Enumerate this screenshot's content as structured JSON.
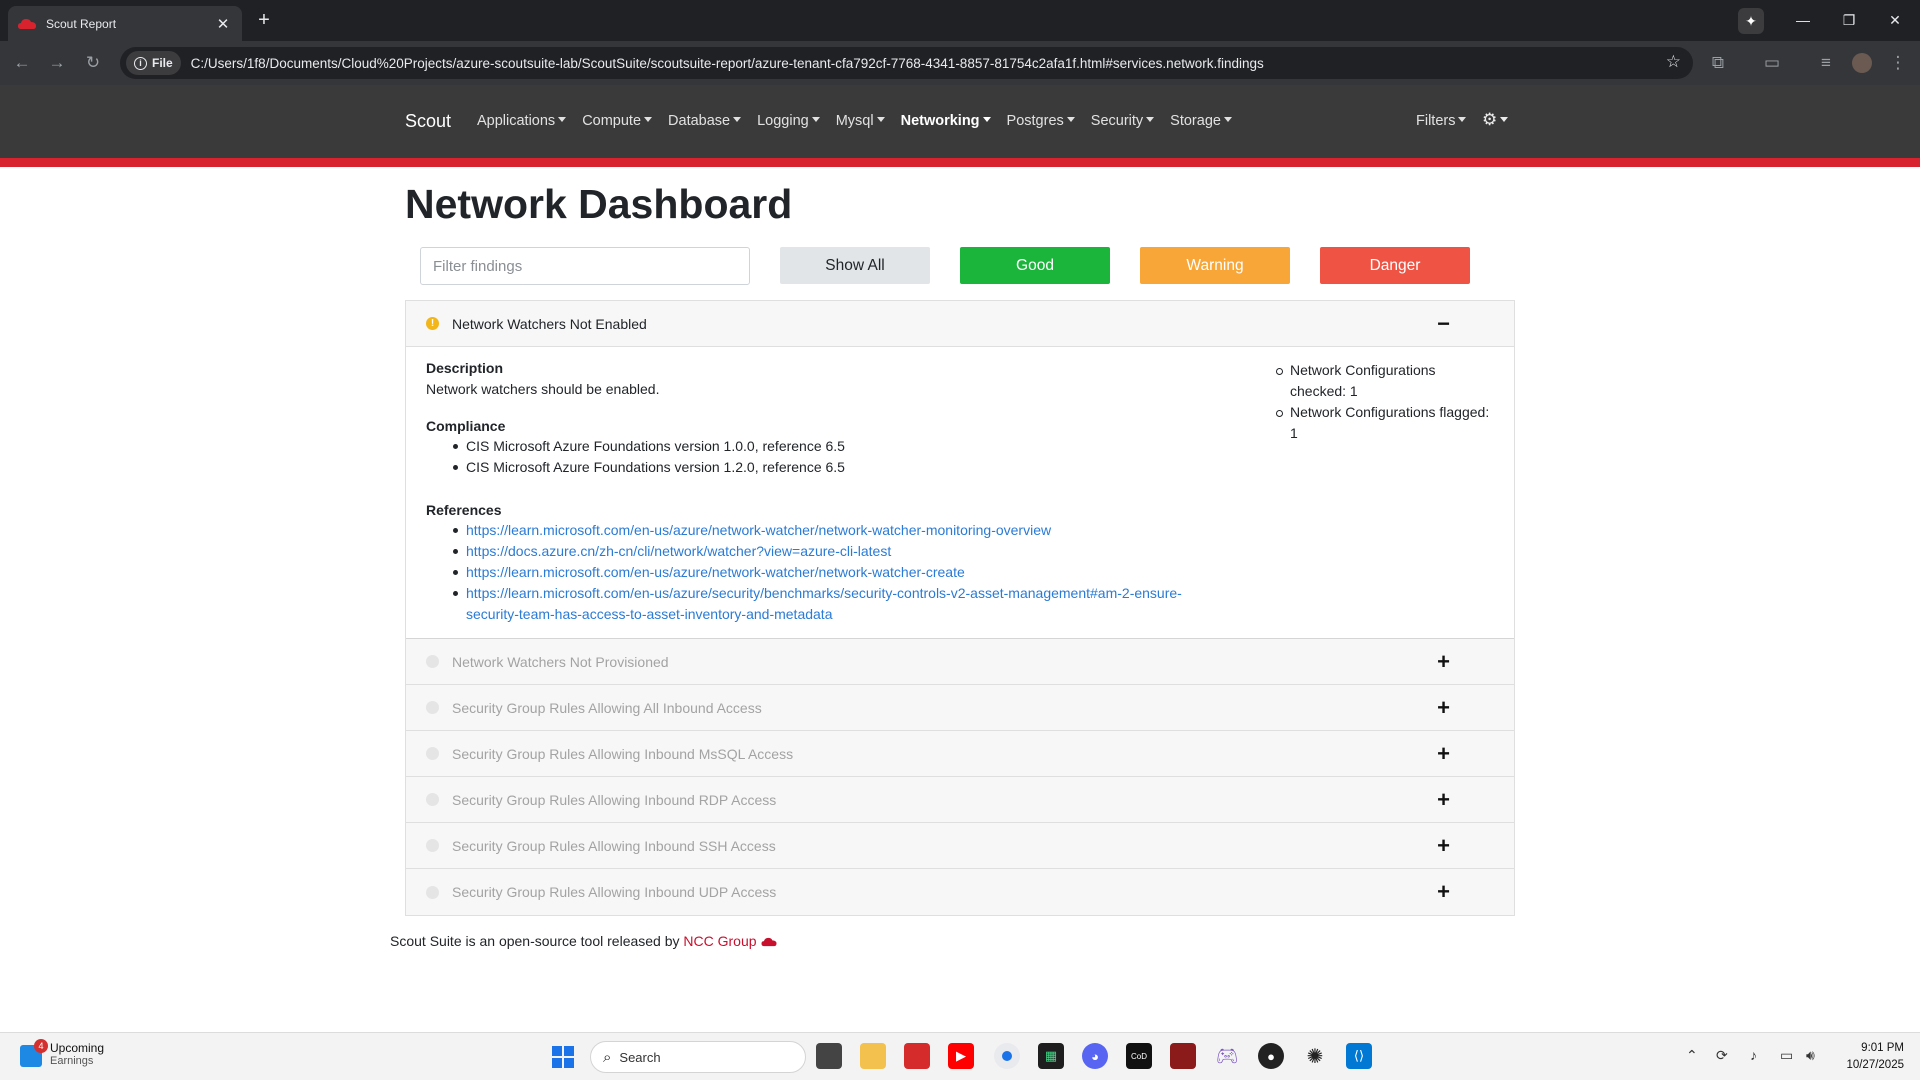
{
  "browser": {
    "tab_title": "Scout Report",
    "tab_close": "✕",
    "new_tab": "+",
    "file_chip": "File",
    "url": "C:/Users/1f8/Documents/Cloud%20Projects/azure-scoutsuite-lab/ScoutSuite/scoutsuite-report/azure-tenant-cfa792cf-7768-4341-8857-81754c2afa1f.html#services.network.findings"
  },
  "nav": {
    "brand": "Scout",
    "menus": [
      "Applications",
      "Compute",
      "Database",
      "Logging",
      "Mysql",
      "Networking",
      "Postgres",
      "Security",
      "Storage"
    ],
    "active": "Networking",
    "filters": "Filters"
  },
  "page": {
    "title": "Network Dashboard",
    "filter_placeholder": "Filter findings",
    "buttons": {
      "show_all": "Show All",
      "good": "Good",
      "warning": "Warning",
      "danger": "Danger"
    }
  },
  "expanded": {
    "title": "Network Watchers Not Enabled",
    "toggle": "−",
    "description_label": "Description",
    "description": "Network watchers should be enabled.",
    "compliance_label": "Compliance",
    "compliance": [
      "CIS Microsoft Azure Foundations version 1.0.0, reference 6.5",
      "CIS Microsoft Azure Foundations version 1.2.0, reference 6.5"
    ],
    "references_label": "References",
    "references": [
      "https://learn.microsoft.com/en-us/azure/network-watcher/network-watcher-monitoring-overview",
      "https://docs.azure.cn/zh-cn/cli/network/watcher?view=azure-cli-latest",
      "https://learn.microsoft.com/en-us/azure/network-watcher/network-watcher-create",
      "https://learn.microsoft.com/en-us/azure/security/benchmarks/security-controls-v2-asset-management#am-2-ensure-",
      "security-team-has-access-to-asset-inventory-and-metadata"
    ],
    "stats": [
      "Network Configurations checked: 1",
      "Network Configurations flagged: 1"
    ]
  },
  "collapsed": [
    "Network Watchers Not Provisioned",
    "Security Group Rules Allowing All Inbound Access",
    "Security Group Rules Allowing Inbound MsSQL Access",
    "Security Group Rules Allowing Inbound RDP Access",
    "Security Group Rules Allowing Inbound SSH Access",
    "Security Group Rules Allowing Inbound UDP Access"
  ],
  "collapsed_toggle": "+",
  "footer": {
    "text": "Scout Suite is an open-source tool released by ",
    "link": "NCC Group"
  },
  "taskbar": {
    "weather_title": "Upcoming",
    "weather_sub": "Earnings",
    "badge": "4",
    "search": "Search",
    "time": "9:01 PM",
    "date": "10/27/2025"
  },
  "colors": {
    "navbar": "#3a3a3a",
    "accent_red": "#d8232f",
    "good": "#1bb53c",
    "warning": "#f8a637",
    "danger": "#ef5344"
  }
}
